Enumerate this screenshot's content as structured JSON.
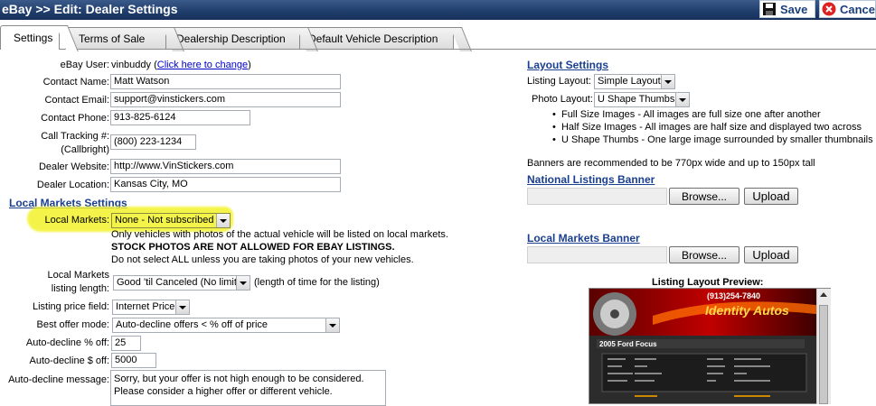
{
  "header": {
    "title": "eBay >> Edit: Dealer Settings",
    "save_label": "Save",
    "cancel_label": "Cancel"
  },
  "tabs": [
    {
      "label": "Settings"
    },
    {
      "label": "Terms of Sale"
    },
    {
      "label": "Dealership Description"
    },
    {
      "label": "Default Vehicle Description"
    }
  ],
  "form": {
    "ebay_user_label": "eBay User:",
    "ebay_user_value": "vinbuddy",
    "ebay_user_change": "Click here to change",
    "contact_name_label": "Contact Name:",
    "contact_name_value": "Matt Watson",
    "contact_email_label": "Contact Email:",
    "contact_email_value": "support@vinstickers.com",
    "contact_phone_label": "Contact Phone:",
    "contact_phone_value": "913-825-6124",
    "call_tracking_label_1": "Call Tracking #:",
    "call_tracking_label_2": "(Callbright)",
    "call_tracking_value": "(800) 223-1234",
    "dealer_website_label": "Dealer Website:",
    "dealer_website_value": "http://www.VinStickers.com",
    "dealer_location_label": "Dealer Location:",
    "dealer_location_value": "Kansas City, MO"
  },
  "local_markets": {
    "section_title": "Local Markets Settings",
    "label": "Local Markets:",
    "value": "None - Not subscribed",
    "note1": "Only vehicles with photos of the actual vehicle will be listed on local markets.",
    "note2": "STOCK PHOTOS ARE NOT ALLOWED FOR EBAY LISTINGS.",
    "note3": "Do not select ALL unless you are taking photos of your new vehicles.",
    "length_label_1": "Local Markets",
    "length_label_2": "listing length:",
    "length_value": "Good 'til Canceled (No limit)",
    "length_note": "(length of time for the listing)",
    "price_label": "Listing price field:",
    "price_value": "Internet Price",
    "best_offer_label": "Best offer mode:",
    "best_offer_value": "Auto-decline offers < % off of price",
    "pct_label": "Auto-decline % off:",
    "pct_value": "25",
    "dollar_label": "Auto-decline $ off:",
    "dollar_value": "5000",
    "msg_label": "Auto-decline message:",
    "msg_line1": "Sorry, but your offer is not high enough to be considered.",
    "msg_line2": "Please consider a higher offer or different vehicle."
  },
  "layout": {
    "section_title": "Layout Settings",
    "listing_label": "Listing Layout:",
    "listing_value": "Simple Layout",
    "photo_label": "Photo Layout:",
    "photo_value": "U Shape Thumbs",
    "bullets": [
      "Full Size Images - All images are full size one after another",
      "Half Size Images - All images are half size and displayed two across",
      "U Shape Thumbs - One large image surrounded by smaller thumbnails"
    ],
    "banner_note": "Banners are recommended to be 770px wide and up to 150px tall",
    "national_title": "National Listings Banner",
    "local_title": "Local Markets Banner",
    "browse_label": "Browse...",
    "upload_label": "Upload",
    "preview_title": "Listing Layout Preview:"
  },
  "preview": {
    "phone": "(913)254-7840",
    "brand": "Identity Autos",
    "car_title": "2005 Ford Focus"
  },
  "colors": {
    "header_bg": "#1f3d6b",
    "section": "#1a3f8f",
    "highlight": "#f2f22a"
  }
}
